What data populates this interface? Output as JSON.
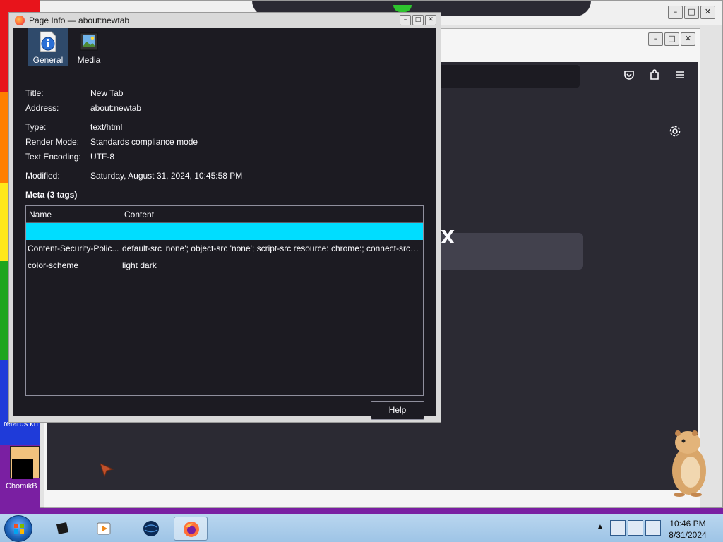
{
  "dialog": {
    "title": "Page Info — about:newtab",
    "tabs": [
      {
        "label": "General",
        "icon": "info-document-icon",
        "active": true
      },
      {
        "label": "Media",
        "icon": "media-image-icon",
        "active": false
      }
    ],
    "general": {
      "title_label": "Title:",
      "title_value": "New Tab",
      "address_label": "Address:",
      "address_value": "about:newtab",
      "type_label": "Type:",
      "type_value": "text/html",
      "render_mode_label": "Render Mode:",
      "render_mode_value": "Standards compliance mode",
      "encoding_label": "Text Encoding:",
      "encoding_value": "UTF-8",
      "modified_label": "Modified:",
      "modified_value": "Saturday, August 31, 2024, 10:45:58 PM"
    },
    "meta": {
      "heading": "Meta (3 tags)",
      "columns": [
        "Name",
        "Content"
      ],
      "rows": [
        {
          "name": "",
          "content": "",
          "selected": true
        },
        {
          "name": "Content-Security-Polic...",
          "content": "default-src 'none'; object-src 'none'; script-src resource: chrome:; connect-src ...",
          "selected": false
        },
        {
          "name": "color-scheme",
          "content": "light dark",
          "selected": false
        }
      ]
    },
    "help_label": "Help",
    "window_buttons": [
      "–",
      "□",
      "✕"
    ]
  },
  "browser": {
    "logo_fragment": "x",
    "toolbar_icons": [
      "pocket-icon",
      "extensions-icon",
      "menu-icon"
    ],
    "settings_icon": "gear-icon"
  },
  "desktop": {
    "icon_text_1": "retards kn",
    "icon_text_2": "ChomikB"
  },
  "taskbar": {
    "clock_time": "10:46 PM",
    "clock_date": "8/31/2024",
    "apps": [
      "monitor-app-icon",
      "media-player-icon",
      "globe-app-icon",
      "firefox-icon"
    ],
    "active_app": "firefox-icon"
  },
  "colors": {
    "selection": "#00ddff",
    "dialog_bg": "#1c1b22",
    "accent_tab": "#2f4a6b"
  }
}
